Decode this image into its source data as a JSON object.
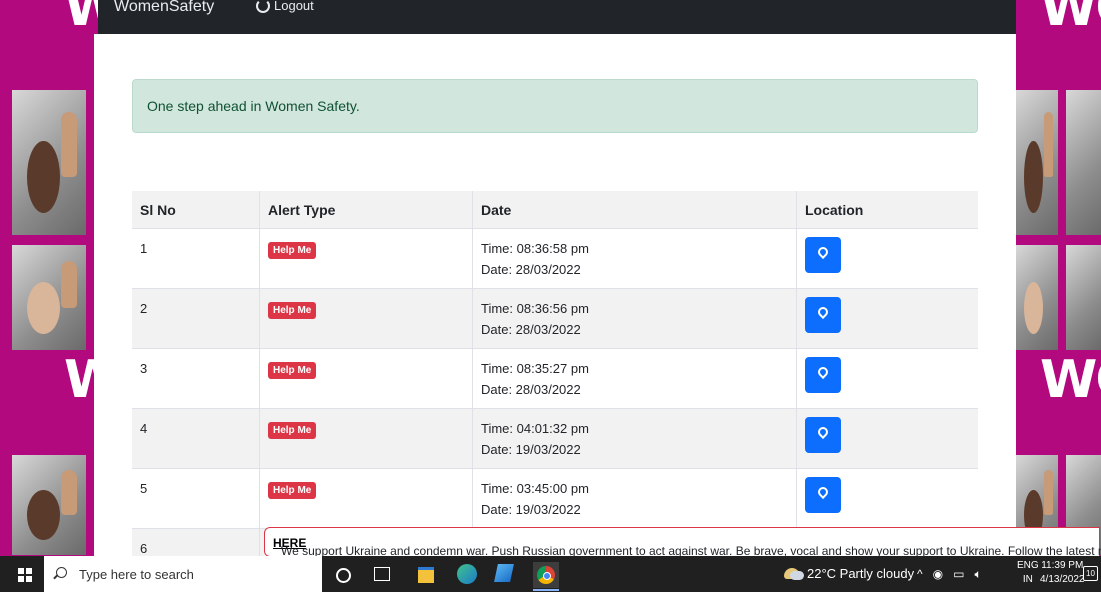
{
  "navbar": {
    "brand": "WomenSafety",
    "logout_label": "Logout"
  },
  "alert": {
    "message": "One step ahead in Women Safety."
  },
  "table": {
    "headers": [
      "Sl No",
      "Alert Type",
      "Date",
      "Location"
    ],
    "rows": [
      {
        "sl": "1",
        "type": "Help Me",
        "time": "Time: 08:36:58 pm",
        "date": "Date: 28/03/2022"
      },
      {
        "sl": "2",
        "type": "Help Me",
        "time": "Time: 08:36:56 pm",
        "date": "Date: 28/03/2022"
      },
      {
        "sl": "3",
        "type": "Help Me",
        "time": "Time: 08:35:27 pm",
        "date": "Date: 28/03/2022"
      },
      {
        "sl": "4",
        "type": "Help Me",
        "time": "Time: 04:01:32 pm",
        "date": "Date: 19/03/2022"
      },
      {
        "sl": "5",
        "type": "Help Me",
        "time": "Time: 03:45:00 pm",
        "date": "Date: 19/03/2022"
      },
      {
        "sl": "6",
        "type": "",
        "time": "",
        "date": ""
      }
    ],
    "location_icon": "map-pin-icon"
  },
  "banner": {
    "text": "We support Ukraine and condemn war. Push Russian government to act against war. Be brave, vocal and show your support to Ukraine. Follow the latest news ",
    "link": "HERE"
  },
  "taskbar": {
    "search_placeholder": "Type here to search",
    "weather": "22°C  Partly cloudy",
    "lang_line1": "ENG",
    "lang_line2": "IN",
    "time": "11:39 PM",
    "date": "4/13/2022",
    "notification_count": "10"
  },
  "background": {
    "letters": [
      "W",
      "WO",
      "W",
      "WO"
    ]
  },
  "colors": {
    "magenta": "#b3097f",
    "navbar": "#212529",
    "alert_bg": "#d1e7dd",
    "badge": "#dc3545",
    "location_button": "#0d6efd"
  }
}
